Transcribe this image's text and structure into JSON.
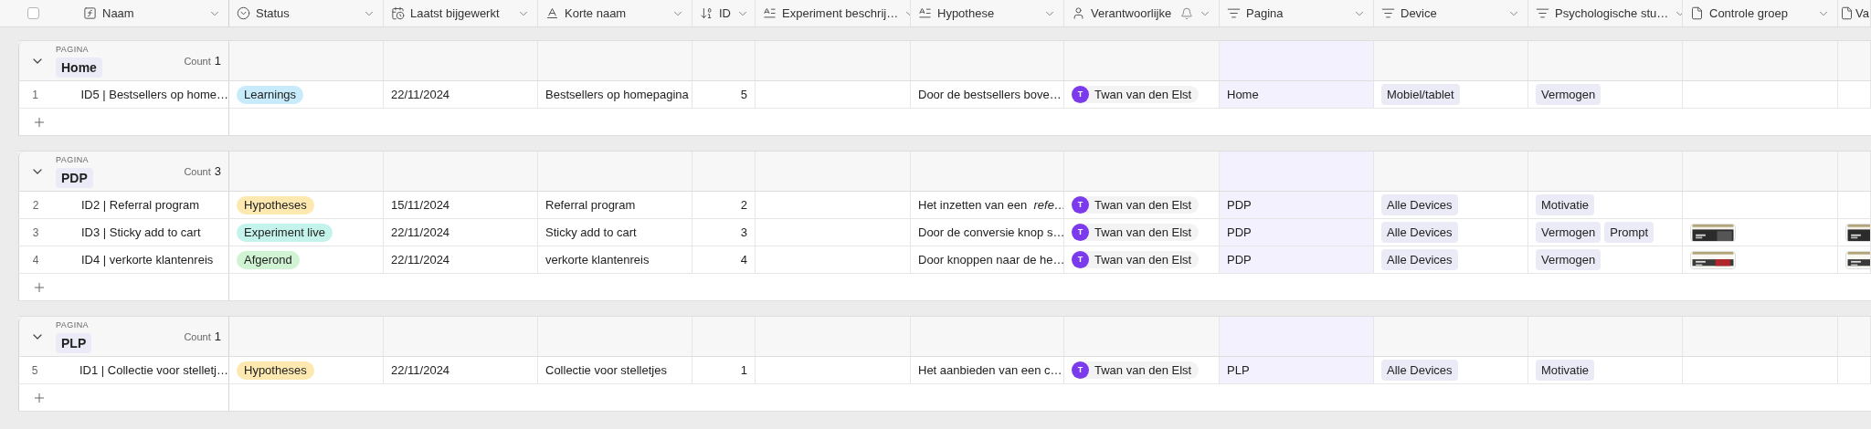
{
  "header": {
    "select_all": {
      "checked": false
    },
    "columns": [
      {
        "label": "Naam",
        "kind": "formula"
      },
      {
        "label": "Status",
        "kind": "status"
      },
      {
        "label": "Laatst bijgewerkt",
        "kind": "date"
      },
      {
        "label": "Korte naam",
        "kind": "text"
      },
      {
        "label": "ID",
        "kind": "number"
      },
      {
        "label": "Experiment beschrij…",
        "kind": "longtext"
      },
      {
        "label": "Hypothese",
        "kind": "longtext"
      },
      {
        "label": "Verantwoorlijke",
        "kind": "person"
      },
      {
        "label": "Pagina",
        "kind": "group"
      },
      {
        "label": "Device",
        "kind": "select"
      },
      {
        "label": "Psychologische stu…",
        "kind": "select"
      },
      {
        "label": "Controle groep",
        "kind": "attachment"
      },
      {
        "label": "Va",
        "kind": "attachment"
      }
    ]
  },
  "groups": [
    {
      "field": "PAGINA",
      "value": "Home",
      "count_label": "Count",
      "count": "1",
      "expanded": true,
      "rows": [
        {
          "number": "1",
          "naam": "ID5 | Bestsellers op home…",
          "status": {
            "label": "Learnings",
            "color": "#c7ebfb"
          },
          "date": "22/11/2024",
          "korte_naam": "Bestsellers op homepagina",
          "id": "5",
          "hypothese": "Door de bestsellers bove…",
          "person": {
            "initial": "T",
            "name": "Twan van den Elst"
          },
          "pagina": "Home",
          "device": [
            "Mobiel/tablet"
          ],
          "psychologische": [
            "Vermogen"
          ],
          "controle": [],
          "column_13": []
        }
      ]
    },
    {
      "field": "PAGINA",
      "value": "PDP",
      "count_label": "Count",
      "count": "3",
      "expanded": true,
      "rows": [
        {
          "number": "2",
          "naam": "ID2 | Referral program",
          "status": {
            "label": "Hypotheses",
            "color": "#fde9b0"
          },
          "date": "15/11/2024",
          "korte_naam": "Referral program",
          "id": "2",
          "hypothese": "Het inzetten van een  *refe…*",
          "person": {
            "initial": "T",
            "name": "Twan van den Elst"
          },
          "pagina": "PDP",
          "device": [
            "Alle Devices"
          ],
          "psychologische": [
            "Motivatie"
          ],
          "controle": [],
          "column_13": []
        },
        {
          "number": "3",
          "naam": "ID3 | Sticky add to cart",
          "status": {
            "label": "Experiment live",
            "color": "#c3f3ea"
          },
          "date": "22/11/2024",
          "korte_naam": "Sticky add to cart",
          "id": "3",
          "hypothese": "Door de conversie knop s…",
          "person": {
            "initial": "T",
            "name": "Twan van den Elst"
          },
          "pagina": "PDP",
          "device": [
            "Alle Devices"
          ],
          "psychologische": [
            "Vermogen",
            "Prompt"
          ],
          "controle": [
            {
              "kind": "picture"
            }
          ],
          "column_13": [
            {
              "kind": "picture"
            }
          ]
        },
        {
          "number": "4",
          "naam": "ID4 | verkorte klantenreis",
          "status": {
            "label": "Afgerond",
            "color": "#cff3d3"
          },
          "date": "22/11/2024",
          "korte_naam": "verkorte klantenreis",
          "id": "4",
          "hypothese": "Door knoppen naar de he…",
          "person": {
            "initial": "T",
            "name": "Twan van den Elst"
          },
          "pagina": "PDP",
          "device": [
            "Alle Devices"
          ],
          "psychologische": [
            "Vermogen"
          ],
          "controle": [
            {
              "kind": "picture"
            }
          ],
          "column_13": [
            {
              "kind": "picture"
            }
          ]
        }
      ]
    },
    {
      "field": "PAGINA",
      "value": "PLP",
      "count_label": "Count",
      "count": "1",
      "expanded": true,
      "rows": [
        {
          "number": "5",
          "naam": "ID1 | Collectie voor stelletj…",
          "status": {
            "label": "Hypotheses",
            "color": "#fde9b0"
          },
          "date": "22/11/2024",
          "korte_naam": "Collectie voor stelletjes",
          "id": "1",
          "hypothese": "Het aanbieden van een c…",
          "person": {
            "initial": "T",
            "name": "Twan van den Elst"
          },
          "pagina": "PLP",
          "device": [
            "Alle Devices"
          ],
          "psychologische": [
            "Motivatie"
          ],
          "controle": [],
          "column_13": []
        }
      ]
    }
  ]
}
